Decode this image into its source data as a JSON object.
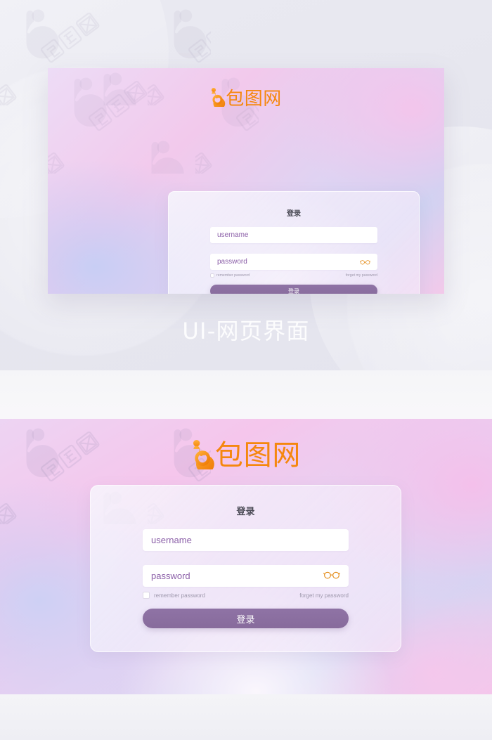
{
  "brand": {
    "name": "包图网",
    "logo_icon": "baotu-b-logo-icon",
    "logo_color": "#f5870e"
  },
  "caption": {
    "text": "UI-网页界面"
  },
  "login_card": {
    "title": "登录",
    "username": {
      "placeholder": "username",
      "value": ""
    },
    "password": {
      "placeholder": "password",
      "value": "",
      "toggle_icon": "glasses-icon",
      "toggle_icon_color": "#e3870f"
    },
    "remember_label": "remember password",
    "remember_checked": false,
    "forgot_label": "forget my password",
    "submit_label": "登录",
    "submit_color": "#8a6f9e"
  },
  "theme": {
    "page_background": "#e9e9f1",
    "gradient_pink": "#f5c6ec",
    "gradient_lavender": "#d3d6f3",
    "gradient_violet": "#edd4f3",
    "text_placeholder": "#8b5fa8",
    "text_muted": "#9e98ac",
    "card_title": "#4a4a55"
  },
  "watermark": {
    "glyph": "包图网",
    "mark": "baotu-b-logo-icon"
  }
}
